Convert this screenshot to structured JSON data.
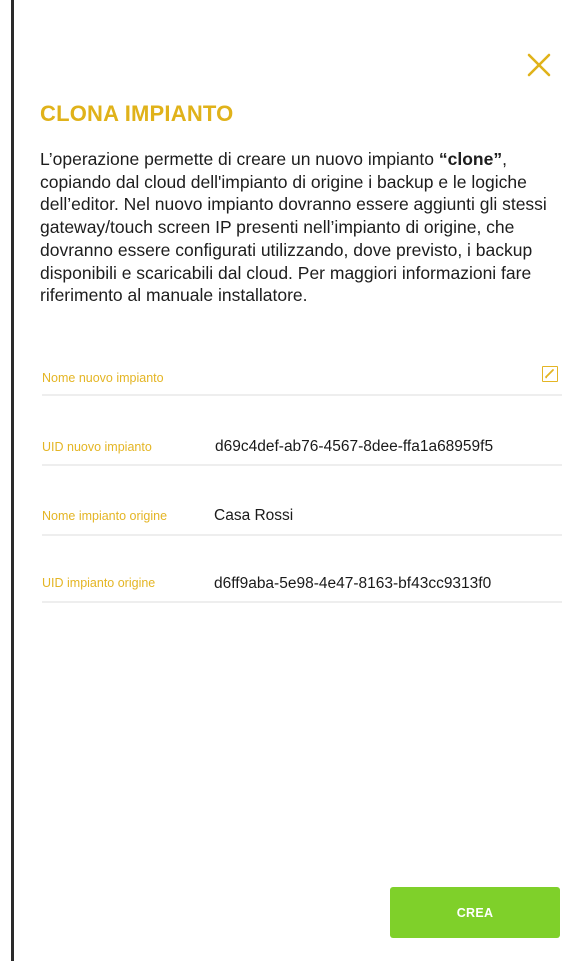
{
  "dialog": {
    "title": "CLONA IMPIANTO",
    "close_icon": "close-icon",
    "description": {
      "before_bold": "L’operazione permette di creare un nuovo impianto ",
      "bold": "“clone”",
      "after_bold": ", copiando dal cloud dell'impianto di origine i backup e le logiche dell’editor. Nel nuovo impianto dovranno essere aggiunti gli stessi gateway/touch screen IP presenti nell’impianto di origine, che dovranno essere configurati utilizzando, dove previsto, i backup disponibili e scaricabili dal cloud. Per maggiori informazioni fare riferimento al manuale installatore."
    },
    "fields": {
      "new_name": {
        "label": "Nome nuovo impianto",
        "value": "",
        "edit_icon": "edit-icon"
      },
      "new_uid": {
        "label": "UID nuovo impianto",
        "value": "d69c4def-ab76-4567-8dee-ffa1a68959f5"
      },
      "origin_name": {
        "label": "Nome impianto origine",
        "value": "Casa Rossi"
      },
      "origin_uid": {
        "label": "UID impianto origine",
        "value": "d6ff9aba-5e98-4e47-8163-bf43cc9313f0"
      }
    },
    "create_button": "CREA"
  },
  "colors": {
    "accent": "#e0b21a",
    "label": "#e4b524",
    "button": "#7fd02a",
    "text": "#1d1d1d"
  }
}
